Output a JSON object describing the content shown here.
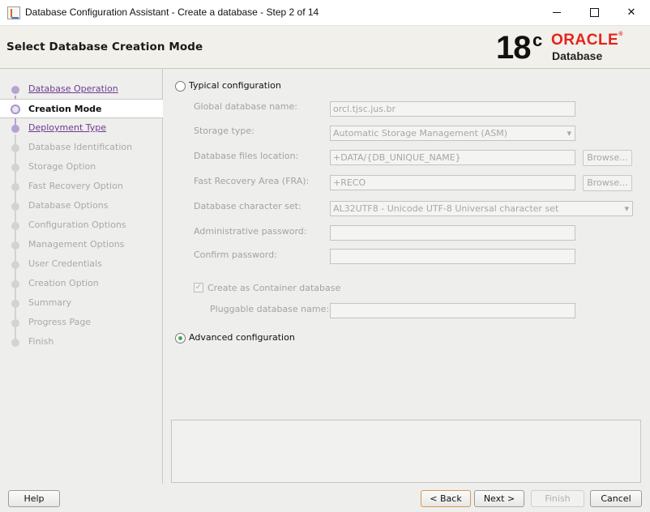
{
  "window": {
    "title": "Database Configuration Assistant - Create a database - Step 2 of 14"
  },
  "header": {
    "page_title": "Select Database Creation Mode",
    "brand_version": "18",
    "brand_version_sup": "c",
    "brand_name": "ORACLE",
    "brand_product": "Database"
  },
  "steps": [
    {
      "label": "Database Operation",
      "state": "done"
    },
    {
      "label": "Creation Mode",
      "state": "active"
    },
    {
      "label": "Deployment Type",
      "state": "done"
    },
    {
      "label": "Database Identification",
      "state": "pending"
    },
    {
      "label": "Storage Option",
      "state": "pending"
    },
    {
      "label": "Fast Recovery Option",
      "state": "pending"
    },
    {
      "label": "Database Options",
      "state": "pending"
    },
    {
      "label": "Configuration Options",
      "state": "pending"
    },
    {
      "label": "Management Options",
      "state": "pending"
    },
    {
      "label": "User Credentials",
      "state": "pending"
    },
    {
      "label": "Creation Option",
      "state": "pending"
    },
    {
      "label": "Summary",
      "state": "pending"
    },
    {
      "label": "Progress Page",
      "state": "pending"
    },
    {
      "label": "Finish",
      "state": "pending"
    }
  ],
  "form": {
    "typical_label": "Typical configuration",
    "typical_selected": false,
    "global_db_name_label": "Global database name:",
    "global_db_name_value": "orcl.tjsc.jus.br",
    "storage_type_label": "Storage type:",
    "storage_type_value": "Automatic Storage Management (ASM)",
    "db_files_location_label": "Database files location:",
    "db_files_location_value": "+DATA/{DB_UNIQUE_NAME}",
    "fra_label": "Fast Recovery Area (FRA):",
    "fra_value": "+RECO",
    "browse_label": "Browse...",
    "charset_label": "Database character set:",
    "charset_value": "AL32UTF8 - Unicode UTF-8 Universal character set",
    "admin_password_label": "Administrative password:",
    "admin_password_value": "",
    "confirm_password_label": "Confirm password:",
    "confirm_password_value": "",
    "container_db_label": "Create as Container database",
    "container_db_checked": true,
    "pdb_name_label": "Pluggable database name:",
    "pdb_name_value": "",
    "advanced_label": "Advanced configuration",
    "advanced_selected": true
  },
  "footer": {
    "help": "Help",
    "back": "< Back",
    "next": "Next >",
    "finish": "Finish",
    "cancel": "Cancel"
  }
}
